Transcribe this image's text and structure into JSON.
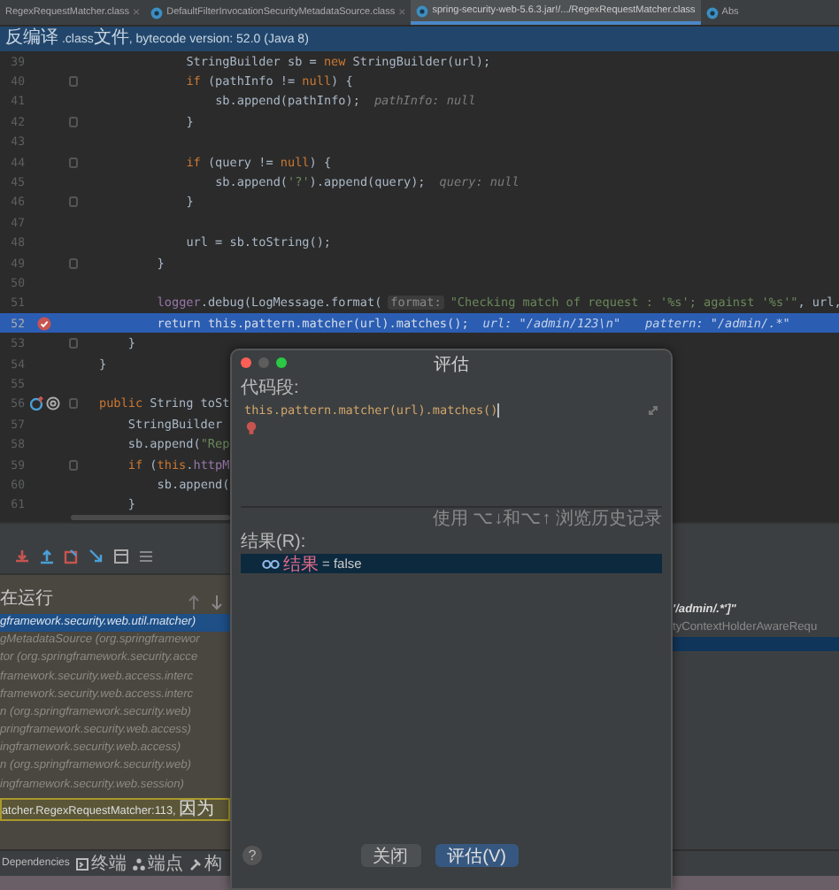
{
  "tabs": [
    {
      "label": "RegexRequestMatcher.class",
      "selected": false,
      "close_glyph": "×"
    },
    {
      "label": "DefaultFilterInvocationSecurityMetadataSource.class",
      "selected": false,
      "close_glyph": "×"
    },
    {
      "label": "spring-security-web-5.6.3.jar!/.../RegexRequestMatcher.class",
      "selected": true
    },
    {
      "label": "Abs",
      "selected": false
    }
  ],
  "banner": "反编译 .class文件, bytecode version: 52.0 (Java 8)",
  "code_lines": [
    {
      "number": "39",
      "fold": false,
      "tokens": [
        {
          "kind": "plain",
          "text": "      StringBuilder sb = "
        },
        {
          "kind": "keyword",
          "text": "new"
        },
        {
          "kind": "plain",
          "text": " StringBuilder(url);"
        }
      ]
    },
    {
      "number": "40",
      "fold": true,
      "tokens": [
        {
          "kind": "keyword",
          "text": "      if"
        },
        {
          "kind": "plain",
          "text": " (pathInfo != "
        },
        {
          "kind": "keyword",
          "text": "null"
        },
        {
          "kind": "plain",
          "text": ") {"
        }
      ]
    },
    {
      "number": "41",
      "fold": false,
      "tokens": [
        {
          "kind": "plain",
          "text": "        sb.append(pathInfo);"
        },
        {
          "kind": "hint",
          "text": "pathInfo: null"
        }
      ]
    },
    {
      "number": "42",
      "fold": true,
      "tokens": [
        {
          "kind": "plain",
          "text": "      }"
        }
      ]
    },
    {
      "number": "43",
      "fold": false
    },
    {
      "number": "44",
      "fold": true,
      "tokens": [
        {
          "kind": "keyword",
          "text": "      if"
        },
        {
          "kind": "plain",
          "text": " (query != "
        },
        {
          "kind": "keyword",
          "text": "null"
        },
        {
          "kind": "plain",
          "text": ") {"
        }
      ]
    },
    {
      "number": "45",
      "fold": false,
      "tokens": [
        {
          "kind": "plain",
          "text": "        sb.append("
        },
        {
          "kind": "string",
          "text": "'?'"
        },
        {
          "kind": "plain",
          "text": ").append(query);"
        },
        {
          "kind": "hint",
          "text": "query: null"
        }
      ]
    },
    {
      "number": "46",
      "fold": true,
      "tokens": [
        {
          "kind": "plain",
          "text": "      }"
        }
      ]
    },
    {
      "number": "47",
      "fold": false
    },
    {
      "number": "48",
      "fold": false,
      "tokens": [
        {
          "kind": "plain",
          "text": "      url = sb.toString();"
        }
      ]
    },
    {
      "number": "49",
      "fold": true,
      "tokens": [
        {
          "kind": "plain",
          "text": "    }"
        }
      ]
    },
    {
      "number": "50",
      "fold": false
    },
    {
      "number": "51",
      "fold": false,
      "tokens": [
        {
          "kind": "field",
          "text": "    logger"
        },
        {
          "kind": "plain",
          "text": ".debug(LogMessage.format("
        },
        {
          "kind": "param",
          "text": "format:"
        },
        {
          "kind": "string",
          "text": "\"Checking match of request : '%s'; against '%s'\""
        },
        {
          "kind": "plain",
          "text": ", url,"
        }
      ]
    },
    {
      "number": "52",
      "fold": false,
      "current": true,
      "breakpoint": true,
      "tokens": [
        {
          "kind": "keyword",
          "text": "    return "
        },
        {
          "kind": "keyword",
          "text": "this"
        },
        {
          "kind": "plain",
          "text": "."
        },
        {
          "kind": "field",
          "text": "pattern"
        },
        {
          "kind": "plain",
          "text": ".matcher(url).matches();"
        },
        {
          "kind": "hint",
          "text": "url: \"/admin/123\\n\""
        },
        {
          "kind": "hint",
          "text": "pattern: \"/admin/.*\""
        }
      ]
    },
    {
      "number": "53",
      "fold": true,
      "tokens": [
        {
          "kind": "plain",
          "text": "  }"
        }
      ]
    },
    {
      "number": "54",
      "fold": false,
      "tokens": [
        {
          "kind": "plain",
          "text": "}"
        }
      ]
    },
    {
      "number": "55",
      "fold": false
    },
    {
      "number": "56",
      "fold": true,
      "override": true,
      "tokens": [
        {
          "kind": "keyword",
          "text": "public"
        },
        {
          "kind": "plain",
          "text": " String toSt"
        }
      ]
    },
    {
      "number": "57",
      "fold": false,
      "tokens": [
        {
          "kind": "plain",
          "text": "  StringBuilder"
        }
      ]
    },
    {
      "number": "58",
      "fold": false,
      "tokens": [
        {
          "kind": "plain",
          "text": "  sb.append("
        },
        {
          "kind": "string",
          "text": "\"Rep"
        }
      ]
    },
    {
      "number": "59",
      "fold": true,
      "tokens": [
        {
          "kind": "keyword",
          "text": "  if"
        },
        {
          "kind": "plain",
          "text": " ("
        },
        {
          "kind": "keyword",
          "text": "this"
        },
        {
          "kind": "plain",
          "text": "."
        },
        {
          "kind": "field",
          "text": "httpM"
        }
      ]
    },
    {
      "number": "60",
      "fold": false,
      "tokens": [
        {
          "kind": "plain",
          "text": "    sb.append("
        }
      ]
    },
    {
      "number": "61",
      "fold": false,
      "tokens": [
        {
          "kind": "plain",
          "text": "  }"
        }
      ]
    }
  ],
  "debugger": {
    "thread_status": "在运行",
    "frames": [
      {
        "text": "gframework.security.web.util.matcher)",
        "selected": true
      },
      {
        "text": "gMetadataSource (org.springframewor",
        "selected": false
      },
      {
        "text": "tor (org.springframework.security.acce",
        "selected": false
      },
      {
        "text": "framework.security.web.access.interc",
        "selected": false
      },
      {
        "text": "framework.security.web.access.interc",
        "selected": false
      },
      {
        "text": "n (org.springframework.security.web)",
        "selected": false
      },
      {
        "text": "pringframework.security.web.access)",
        "selected": false
      },
      {
        "text": "ingframework.security.web.access)",
        "selected": false
      },
      {
        "text": "n (org.springframework.security.web)",
        "selected": false
      },
      {
        "text": "ingframework.security.web.session)",
        "selected": false
      }
    ],
    "hint_bar": "atcher.RegexRequestMatcher:113, 因为",
    "variables": [
      "'/admin/.*']\"",
      "tyContextHolderAwareRequ"
    ]
  },
  "tool_tabs": [
    "Dependencies",
    "终端",
    "端点",
    "构"
  ],
  "evaluate_dialog": {
    "title": "评估",
    "window_controls": [
      {
        "color": "#ff5f57"
      },
      {
        "color": "#5d5d5d"
      },
      {
        "color": "#2ac845"
      }
    ],
    "code_label": "代码段:",
    "expression": "this.pattern.matcher(url).matches()",
    "history_hint": "使用 ⌥↓和⌥↑ 浏览历史记录",
    "result_label": "结果(R):",
    "result": {
      "name": "结果",
      "value": "= false",
      "selected": true
    },
    "help": "?",
    "buttons": [
      {
        "label": "关闭",
        "primary": false
      },
      {
        "label": "评估(V)",
        "primary": true
      }
    ]
  }
}
